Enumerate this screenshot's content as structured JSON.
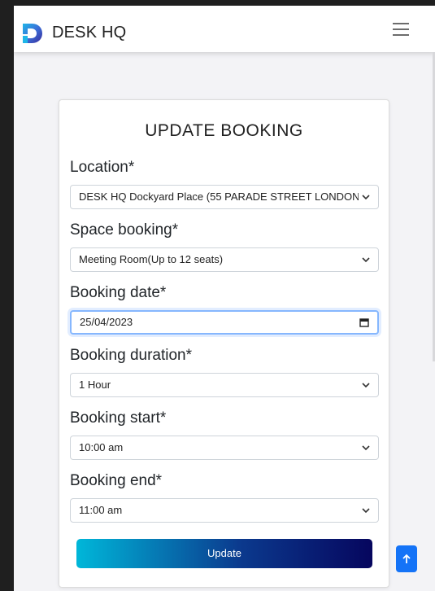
{
  "navbar": {
    "brand": "DESK HQ",
    "logo_icon": "desk-hq-logo",
    "menu_icon": "hamburger-menu-icon"
  },
  "form": {
    "title": "UPDATE BOOKING",
    "location": {
      "label": "Location*",
      "value": "DESK HQ Dockyard Place (55 PARADE STREET LONDON E20 ..."
    },
    "space": {
      "label": "Space booking*",
      "value": "Meeting Room(Up to 12 seats)"
    },
    "date": {
      "label": "Booking date*",
      "value": "25/04/2023"
    },
    "duration": {
      "label": "Booking duration*",
      "value": "1 Hour"
    },
    "start": {
      "label": "Booking start*",
      "value": "10:00 am"
    },
    "end": {
      "label": "Booking end*",
      "value": "11:00 am"
    },
    "submit_label": "Update"
  },
  "colors": {
    "accent_start": "#00b7d9",
    "accent_end": "#06065e",
    "scroll_top_button": "#1473f7",
    "focus_border": "#86b7fe"
  },
  "scroll_top_icon": "arrow-up-icon"
}
